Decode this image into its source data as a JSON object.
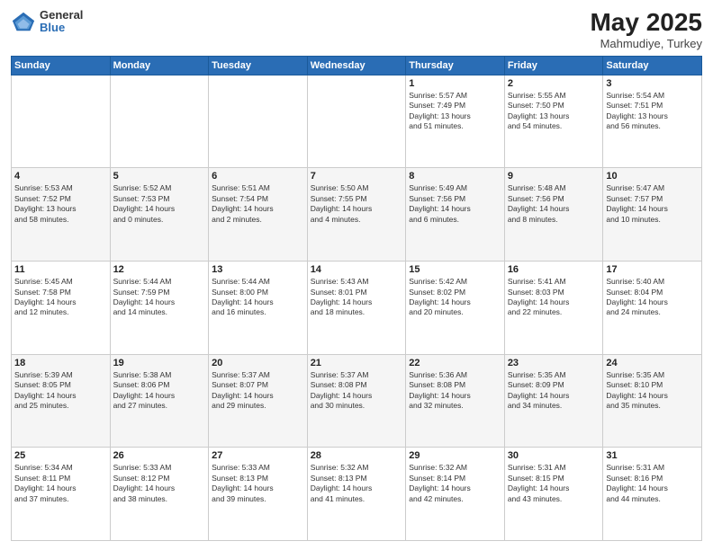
{
  "header": {
    "logo": {
      "general": "General",
      "blue": "Blue"
    },
    "title": "May 2025",
    "location": "Mahmudiye, Turkey"
  },
  "weekdays": [
    "Sunday",
    "Monday",
    "Tuesday",
    "Wednesday",
    "Thursday",
    "Friday",
    "Saturday"
  ],
  "weeks": [
    [
      {
        "day": "",
        "info": ""
      },
      {
        "day": "",
        "info": ""
      },
      {
        "day": "",
        "info": ""
      },
      {
        "day": "",
        "info": ""
      },
      {
        "day": "1",
        "info": "Sunrise: 5:57 AM\nSunset: 7:49 PM\nDaylight: 13 hours\nand 51 minutes."
      },
      {
        "day": "2",
        "info": "Sunrise: 5:55 AM\nSunset: 7:50 PM\nDaylight: 13 hours\nand 54 minutes."
      },
      {
        "day": "3",
        "info": "Sunrise: 5:54 AM\nSunset: 7:51 PM\nDaylight: 13 hours\nand 56 minutes."
      }
    ],
    [
      {
        "day": "4",
        "info": "Sunrise: 5:53 AM\nSunset: 7:52 PM\nDaylight: 13 hours\nand 58 minutes."
      },
      {
        "day": "5",
        "info": "Sunrise: 5:52 AM\nSunset: 7:53 PM\nDaylight: 14 hours\nand 0 minutes."
      },
      {
        "day": "6",
        "info": "Sunrise: 5:51 AM\nSunset: 7:54 PM\nDaylight: 14 hours\nand 2 minutes."
      },
      {
        "day": "7",
        "info": "Sunrise: 5:50 AM\nSunset: 7:55 PM\nDaylight: 14 hours\nand 4 minutes."
      },
      {
        "day": "8",
        "info": "Sunrise: 5:49 AM\nSunset: 7:56 PM\nDaylight: 14 hours\nand 6 minutes."
      },
      {
        "day": "9",
        "info": "Sunrise: 5:48 AM\nSunset: 7:56 PM\nDaylight: 14 hours\nand 8 minutes."
      },
      {
        "day": "10",
        "info": "Sunrise: 5:47 AM\nSunset: 7:57 PM\nDaylight: 14 hours\nand 10 minutes."
      }
    ],
    [
      {
        "day": "11",
        "info": "Sunrise: 5:45 AM\nSunset: 7:58 PM\nDaylight: 14 hours\nand 12 minutes."
      },
      {
        "day": "12",
        "info": "Sunrise: 5:44 AM\nSunset: 7:59 PM\nDaylight: 14 hours\nand 14 minutes."
      },
      {
        "day": "13",
        "info": "Sunrise: 5:44 AM\nSunset: 8:00 PM\nDaylight: 14 hours\nand 16 minutes."
      },
      {
        "day": "14",
        "info": "Sunrise: 5:43 AM\nSunset: 8:01 PM\nDaylight: 14 hours\nand 18 minutes."
      },
      {
        "day": "15",
        "info": "Sunrise: 5:42 AM\nSunset: 8:02 PM\nDaylight: 14 hours\nand 20 minutes."
      },
      {
        "day": "16",
        "info": "Sunrise: 5:41 AM\nSunset: 8:03 PM\nDaylight: 14 hours\nand 22 minutes."
      },
      {
        "day": "17",
        "info": "Sunrise: 5:40 AM\nSunset: 8:04 PM\nDaylight: 14 hours\nand 24 minutes."
      }
    ],
    [
      {
        "day": "18",
        "info": "Sunrise: 5:39 AM\nSunset: 8:05 PM\nDaylight: 14 hours\nand 25 minutes."
      },
      {
        "day": "19",
        "info": "Sunrise: 5:38 AM\nSunset: 8:06 PM\nDaylight: 14 hours\nand 27 minutes."
      },
      {
        "day": "20",
        "info": "Sunrise: 5:37 AM\nSunset: 8:07 PM\nDaylight: 14 hours\nand 29 minutes."
      },
      {
        "day": "21",
        "info": "Sunrise: 5:37 AM\nSunset: 8:08 PM\nDaylight: 14 hours\nand 30 minutes."
      },
      {
        "day": "22",
        "info": "Sunrise: 5:36 AM\nSunset: 8:08 PM\nDaylight: 14 hours\nand 32 minutes."
      },
      {
        "day": "23",
        "info": "Sunrise: 5:35 AM\nSunset: 8:09 PM\nDaylight: 14 hours\nand 34 minutes."
      },
      {
        "day": "24",
        "info": "Sunrise: 5:35 AM\nSunset: 8:10 PM\nDaylight: 14 hours\nand 35 minutes."
      }
    ],
    [
      {
        "day": "25",
        "info": "Sunrise: 5:34 AM\nSunset: 8:11 PM\nDaylight: 14 hours\nand 37 minutes."
      },
      {
        "day": "26",
        "info": "Sunrise: 5:33 AM\nSunset: 8:12 PM\nDaylight: 14 hours\nand 38 minutes."
      },
      {
        "day": "27",
        "info": "Sunrise: 5:33 AM\nSunset: 8:13 PM\nDaylight: 14 hours\nand 39 minutes."
      },
      {
        "day": "28",
        "info": "Sunrise: 5:32 AM\nSunset: 8:13 PM\nDaylight: 14 hours\nand 41 minutes."
      },
      {
        "day": "29",
        "info": "Sunrise: 5:32 AM\nSunset: 8:14 PM\nDaylight: 14 hours\nand 42 minutes."
      },
      {
        "day": "30",
        "info": "Sunrise: 5:31 AM\nSunset: 8:15 PM\nDaylight: 14 hours\nand 43 minutes."
      },
      {
        "day": "31",
        "info": "Sunrise: 5:31 AM\nSunset: 8:16 PM\nDaylight: 14 hours\nand 44 minutes."
      }
    ]
  ],
  "colors": {
    "header_bg": "#2a6db5",
    "row_alt": "#eef2f8"
  }
}
